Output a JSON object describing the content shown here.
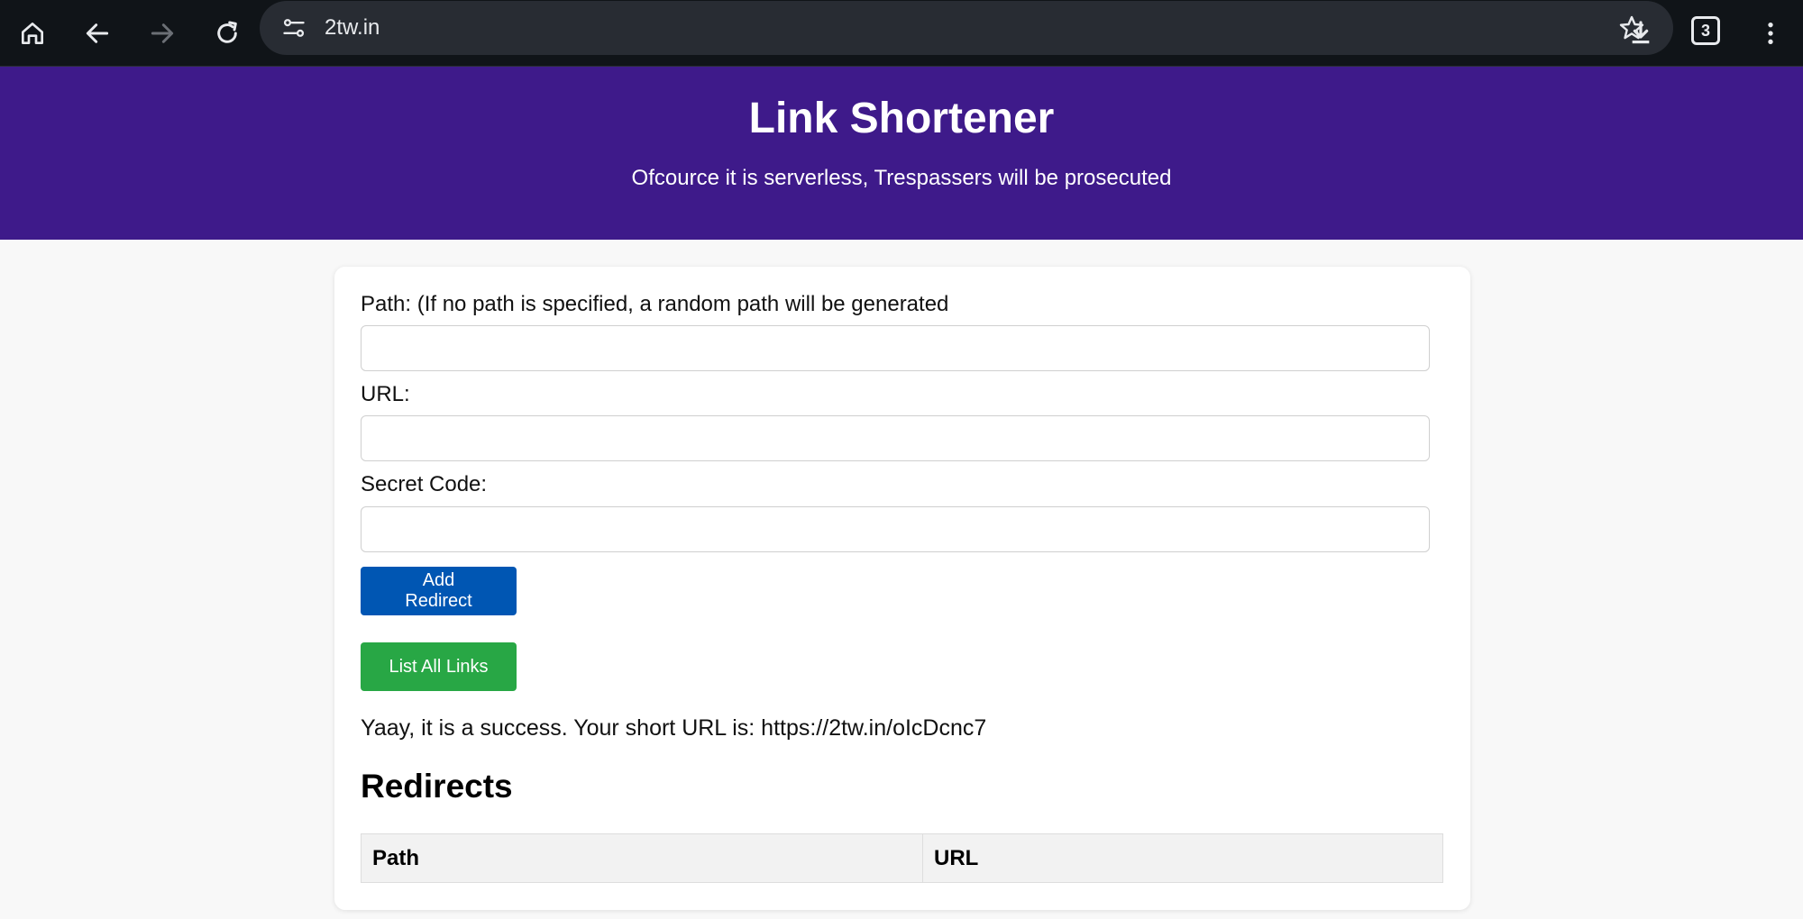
{
  "browser": {
    "address": "2tw.in",
    "tab_count": "3",
    "icons": [
      "home-icon",
      "back-icon",
      "forward-icon",
      "reload-icon",
      "site-settings-icon",
      "bookmark-star-icon",
      "download-icon",
      "tab-switcher-icon",
      "menu-icon"
    ]
  },
  "header": {
    "title": "Link Shortener",
    "subtitle": "Ofcource it is serverless, Trespassers will be prosecuted",
    "background_color": "#3e1a8a"
  },
  "form": {
    "path_label": "Path: (If no path is specified, a random path will be generated",
    "path_value": "",
    "url_label": "URL:",
    "url_value": "",
    "secret_label": "Secret Code:",
    "secret_value": "",
    "add_button": "Add Redirect",
    "list_button": "List All Links"
  },
  "result": {
    "message": "Yaay, it is a success. Your short URL is: https://2tw.in/oIcDcnc7"
  },
  "redirects": {
    "title": "Redirects",
    "columns": [
      "Path",
      "URL"
    ],
    "rows": []
  },
  "colors": {
    "primary_button": "#0056b3",
    "success_button": "#28a745",
    "browser_bar": "#101418"
  }
}
